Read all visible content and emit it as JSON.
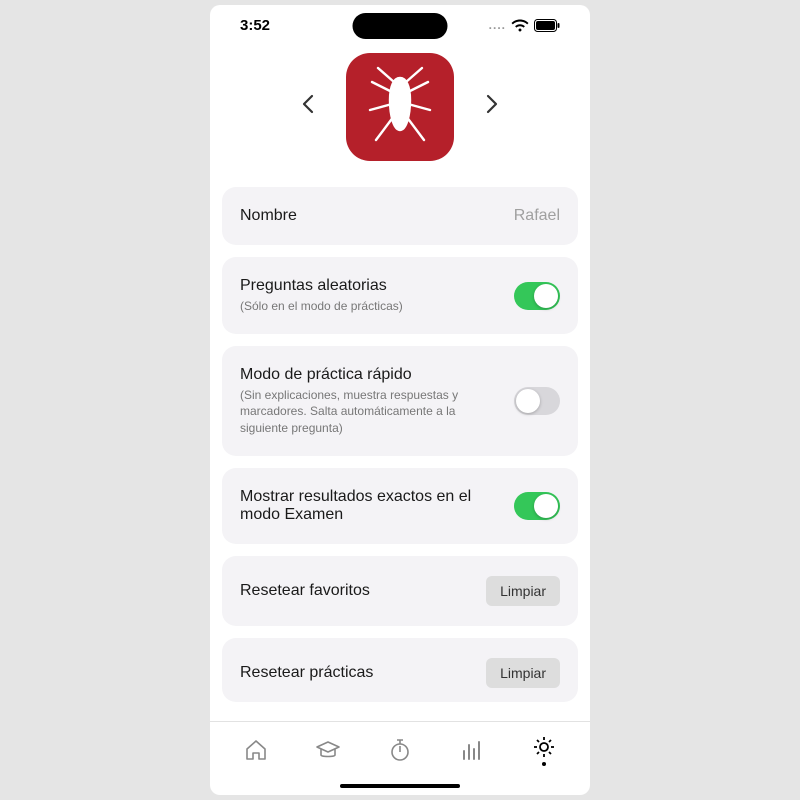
{
  "status": {
    "time": "3:52",
    "dots": "...."
  },
  "rows": {
    "name": {
      "label": "Nombre",
      "value": "Rafael"
    },
    "random": {
      "label": "Preguntas aleatorias",
      "sub": "(Sólo en el modo de prácticas)",
      "on": true
    },
    "fast": {
      "label": "Modo de práctica rápido",
      "sub": "(Sin explicaciones, muestra respuestas y marcadores. Salta automáticamente a la siguiente pregunta)",
      "on": false
    },
    "exact": {
      "label": "Mostrar resultados exactos en el modo Examen",
      "on": true
    },
    "resetFav": {
      "label": "Resetear favoritos",
      "button": "Limpiar"
    },
    "resetPractice": {
      "label": "Resetear prácticas",
      "button": "Limpiar"
    }
  }
}
